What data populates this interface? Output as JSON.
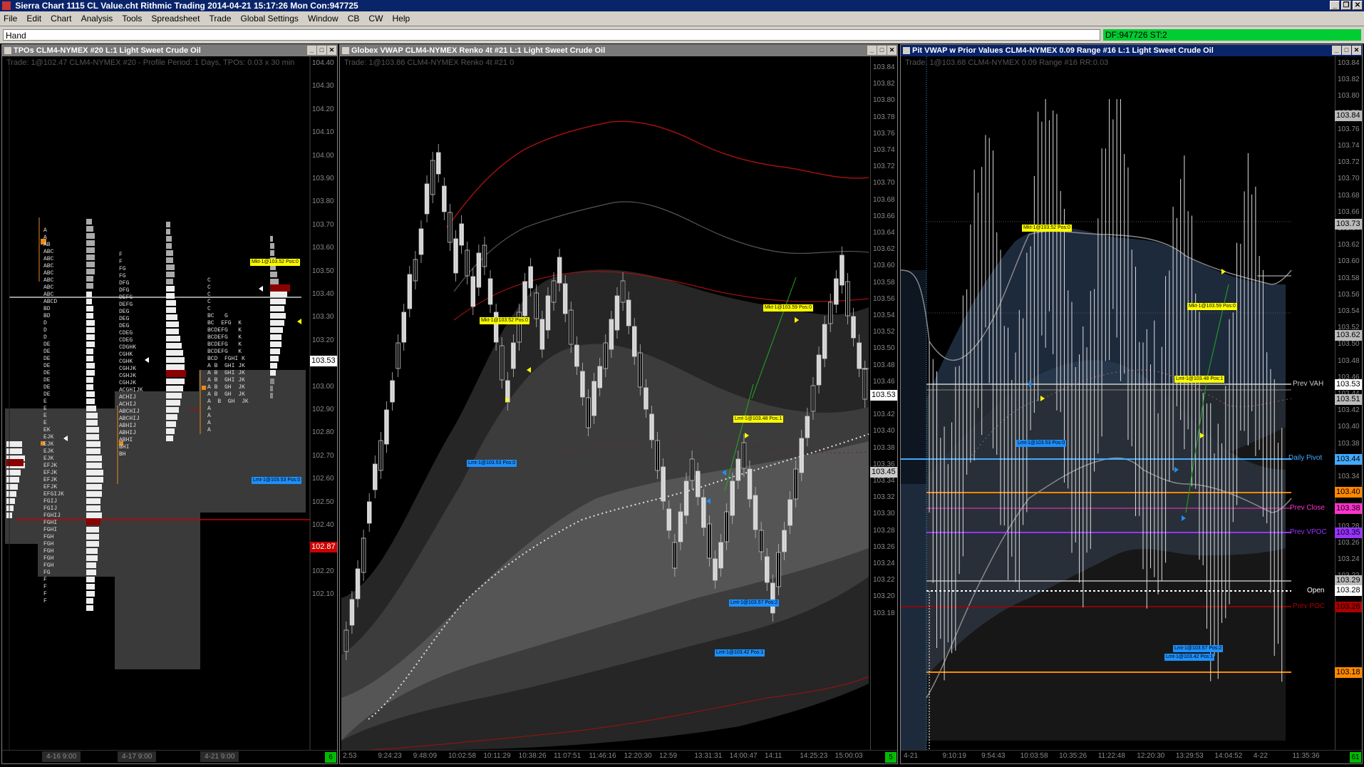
{
  "app": {
    "title": "Sierra Chart 1115 CL Value.cht  Rithmic Trading 2014-04-21  15:17:26 Mon  Con:947725",
    "window_buttons": [
      "_",
      "❐",
      "✕"
    ]
  },
  "menu": [
    "File",
    "Edit",
    "Chart",
    "Analysis",
    "Tools",
    "Spreadsheet",
    "Trade",
    "Global Settings",
    "Window",
    "CB",
    "CW",
    "Help"
  ],
  "toolbar": {
    "mode": "Hand",
    "status": "DF:947726  ST:2",
    "status_color": "#00cc33"
  },
  "panel_tpo": {
    "title": "TPOs  CLM4-NYMEX  #20  L:1  Light Sweet Crude Oil",
    "subtitle": "Trade: 1@102.47  CLM4-NYMEX  #20 - Profile Period: 1 Days, TPOs: 0.03 x 30 min",
    "price_scale": [
      "104.40",
      "104.30",
      "104.20",
      "104.10",
      "104.00",
      "103.90",
      "103.80",
      "103.70",
      "103.60",
      "103.50",
      "103.40",
      "103.30",
      "103.20",
      "103.10",
      "103.00",
      "102.90",
      "102.80",
      "102.70",
      "102.60",
      "102.50",
      "102.40",
      "102.30",
      "102.20",
      "102.10"
    ],
    "last_price": "103.53",
    "red_price": "102.87",
    "dates": [
      "4-16  9:00",
      "4-17  9:00",
      "4-21  9:00"
    ],
    "green_box": "6",
    "profile1_letters": [
      "A",
      "A",
      "AB",
      "ABC",
      "ABC",
      "ABC",
      "ABC",
      "ABC",
      "ABC",
      "ABC",
      "ABCD",
      "BD",
      "BD",
      "D",
      "D",
      "D",
      "DE",
      "DE",
      "DE",
      "DE",
      "DE",
      "DE",
      "DE",
      "DE",
      "E",
      "E",
      "E",
      "E",
      "EK",
      "EJK",
      "EJK",
      "EJK",
      "EJK",
      "EFJK",
      "EFJK",
      "EFJK",
      "EFJK",
      "EFGIJK",
      "FGIJ",
      "FGIJ",
      "FGHIJ",
      "FGHI",
      "FGHI",
      "FGH",
      "FGH",
      "FGH",
      "FGH",
      "FGH",
      "FG",
      "F",
      "F",
      "F",
      "F"
    ],
    "profile2_letters": [
      "F",
      "F",
      "FG",
      "FG",
      "DFG",
      "DFG",
      "DEFG",
      "DEFG",
      "DEG",
      "DEG",
      "DEG",
      "CDEG",
      "CDEG",
      "CDGHK",
      "CGHK",
      "CGHK",
      "CGHJK",
      "CGHJK",
      "CGHJK",
      "ACGHIJK",
      "ACHIJ",
      "ACHIJ",
      "ABCHIJ",
      "ABCHIJ",
      "ABHIJ",
      "ABHIJ",
      "ABHI",
      "BHI",
      "BH"
    ],
    "profile3_letters": [
      "C",
      "C",
      "C",
      "C",
      "C",
      "BC   G",
      "BC  EFG  K",
      "BCDEFG   K",
      "BCDEFG   K",
      "BCDEFG   K",
      "BCDEFG   K",
      "BCD  FGHI K",
      "A B  GHI JK",
      "A B  GHI JK",
      "A B  GHI JK",
      "A B  GH  JK",
      "A B  GH  JK",
      "A  B  GH  JK",
      "A",
      "A",
      "A",
      "A"
    ],
    "orders": [
      {
        "text": "Mkt-1@103.52 Pos:0",
        "type": "y"
      },
      {
        "text": "Lmt-1@103.53 Pos:0",
        "type": "b"
      }
    ]
  },
  "panel_renko": {
    "title": "Globex VWAP  CLM4-NYMEX  Renko 4t  #21  L:1  Light Sweet Crude Oil",
    "subtitle": "Trade: 1@103.86  CLM4-NYMEX  Renko 4t  #21 0",
    "price_scale": [
      "103.84",
      "103.82",
      "103.80",
      "103.78",
      "103.76",
      "103.74",
      "103.72",
      "103.70",
      "103.68",
      "103.66",
      "103.64",
      "103.62",
      "103.60",
      "103.58",
      "103.56",
      "103.54",
      "103.52",
      "103.50",
      "103.48",
      "103.46",
      "103.44",
      "103.42",
      "103.40",
      "103.38",
      "103.36",
      "103.34",
      "103.32",
      "103.30",
      "103.28",
      "103.26",
      "103.24",
      "103.22",
      "103.20",
      "103.18"
    ],
    "current_price": "103.53",
    "price2": "103.45",
    "times": [
      "2:53",
      "9:24:23",
      "9:48:09",
      "10:02:58",
      "10:11:29",
      "10:38:26",
      "11:07:51",
      "11:46:16",
      "12:20:30",
      "12:59",
      "13:31:31",
      "14:00:47",
      "14:11",
      "14:25:23",
      "15:00:03"
    ],
    "green_box": "5",
    "orders": [
      {
        "text": "Mkt-1@103.52 Pos:0",
        "type": "y"
      },
      {
        "text": "Mkt-1@103.59 Pos:0",
        "type": "y"
      },
      {
        "text": "Lmt-1@103.48 Pos:1",
        "type": "y"
      },
      {
        "text": "Lmt-1@103.53 Pos:0",
        "type": "b"
      },
      {
        "text": "Lmt-1@103.57 Pos:2",
        "type": "b"
      },
      {
        "text": "Lmt-1@103.42 Pos:1",
        "type": "b"
      }
    ]
  },
  "panel_pit": {
    "title": "Pit VWAP w Prior Values  CLM4-NYMEX  0.09 Range  #16  L:1  Light Sweet Crude Oil",
    "subtitle": "Trade: 1@103.68  CLM4-NYMEX  0.09 Range  #16 RR:0.03",
    "price_scale": [
      "103.84",
      "103.82",
      "103.80",
      "103.78",
      "103.76",
      "103.74",
      "103.72",
      "103.70",
      "103.68",
      "103.66",
      "103.64",
      "103.62",
      "103.60",
      "103.58",
      "103.56",
      "103.54",
      "103.52",
      "103.50",
      "103.48",
      "103.46",
      "103.44",
      "103.42",
      "103.40",
      "103.38",
      "103.36",
      "103.34",
      "103.32",
      "103.30",
      "103.28",
      "103.26",
      "103.24",
      "103.22",
      "103.20",
      "103.18"
    ],
    "levels": [
      {
        "label": "Prev VAH",
        "value": "103.53",
        "color": "#cccccc",
        "bg": "#ffffff"
      },
      {
        "label": "",
        "value": "103.51",
        "color": "#cccccc",
        "bg": "#bbbbbb"
      },
      {
        "label": "Daily Pivot",
        "value": "103.44",
        "color": "#44aaff",
        "bg": "#44aaff"
      },
      {
        "label": "",
        "value": "103.40",
        "color": "#ff8800",
        "bg": "#ff8800"
      },
      {
        "label": "Prev Close",
        "value": "103.38",
        "color": "#ff33cc",
        "bg": "#ff33cc"
      },
      {
        "label": "Prev VPOC",
        "value": "103.35",
        "color": "#9933ff",
        "bg": "#9933ff"
      },
      {
        "label": "",
        "value": "103.29",
        "color": "#cccccc",
        "bg": "#bbbbbb"
      },
      {
        "label": "Open",
        "value": "103.28",
        "color": "#ffffff",
        "bg": "#ffffff"
      },
      {
        "label": "Prev POC",
        "value": "103.26",
        "color": "#aa0000",
        "bg": "#aa0000"
      },
      {
        "label": "",
        "value": "103.18",
        "color": "#ff8800",
        "bg": "#ff8800"
      }
    ],
    "top_labels": [
      "103.84",
      "103.73",
      "103.62"
    ],
    "times": [
      "4-21",
      "9:10:19",
      "9:54:43",
      "10:03:58",
      "10:35:26",
      "11:22:48",
      "12:20:30",
      "13:29:53",
      "14:04:52",
      "4-22",
      "11:35:36"
    ],
    "green_box": "61",
    "orders": [
      {
        "text": "Mkt-1@103.52 Pos:0",
        "type": "y"
      },
      {
        "text": "Mkt-1@103.59 Pos:0",
        "type": "y"
      },
      {
        "text": "Lmt-1@103.48 Pos:1",
        "type": "y"
      },
      {
        "text": "Lmt-1@103.53 Pos:0",
        "type": "b"
      },
      {
        "text": "Lmt-1@103.57 Pos:2",
        "type": "b"
      },
      {
        "text": "Lmt-1@103.42 Pos:1",
        "type": "b"
      }
    ]
  }
}
